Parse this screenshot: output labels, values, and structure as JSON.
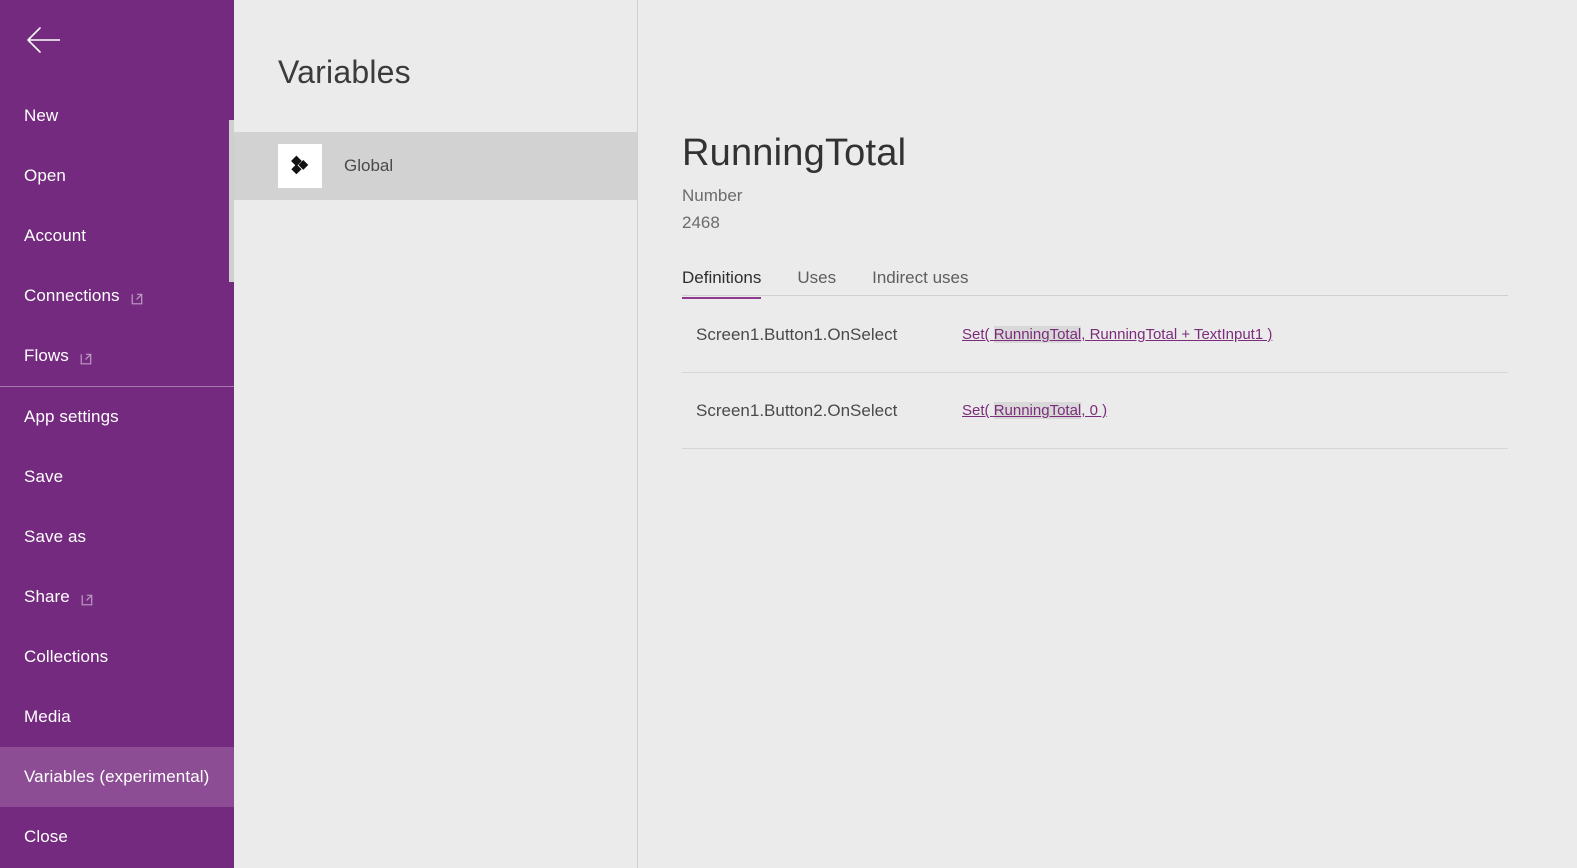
{
  "sidebar": {
    "back_icon": "back-arrow-icon",
    "accent_color": "#742a7f",
    "selected_color": "#8c4d94",
    "items": [
      {
        "label": "New",
        "external": false,
        "selected": false
      },
      {
        "label": "Open",
        "external": false,
        "selected": false
      },
      {
        "label": "Account",
        "external": false,
        "selected": false
      },
      {
        "label": "Connections",
        "external": true,
        "selected": false
      },
      {
        "label": "Flows",
        "external": true,
        "selected": false
      },
      {
        "label": "App settings",
        "external": false,
        "selected": false
      },
      {
        "label": "Save",
        "external": false,
        "selected": false
      },
      {
        "label": "Save as",
        "external": false,
        "selected": false
      },
      {
        "label": "Share",
        "external": true,
        "selected": false
      },
      {
        "label": "Collections",
        "external": false,
        "selected": false
      },
      {
        "label": "Media",
        "external": false,
        "selected": false
      },
      {
        "label": "Variables (experimental)",
        "external": false,
        "selected": true
      },
      {
        "label": "Close",
        "external": false,
        "selected": false
      }
    ],
    "divider_after_index": 4
  },
  "list_panel": {
    "title": "Variables",
    "items": [
      {
        "label": "Global",
        "icon": "global-variables-icon",
        "selected": true
      }
    ]
  },
  "main": {
    "variable_name": "RunningTotal",
    "variable_type": "Number",
    "variable_value": "2468",
    "tabs": [
      {
        "label": "Definitions",
        "active": true
      },
      {
        "label": "Uses",
        "active": false
      },
      {
        "label": "Indirect uses",
        "active": false
      }
    ],
    "tab_accent_color": "#8e3a8e",
    "definitions": [
      {
        "property": "Screen1.Button1.OnSelect",
        "formula_prefix": "Set( ",
        "formula_highlight": "RunningTotal",
        "formula_suffix": ", RunningTotal + TextInput1 )"
      },
      {
        "property": "Screen1.Button2.OnSelect",
        "formula_prefix": "Set( ",
        "formula_highlight": "RunningTotal",
        "formula_suffix": ", 0 )"
      }
    ]
  }
}
